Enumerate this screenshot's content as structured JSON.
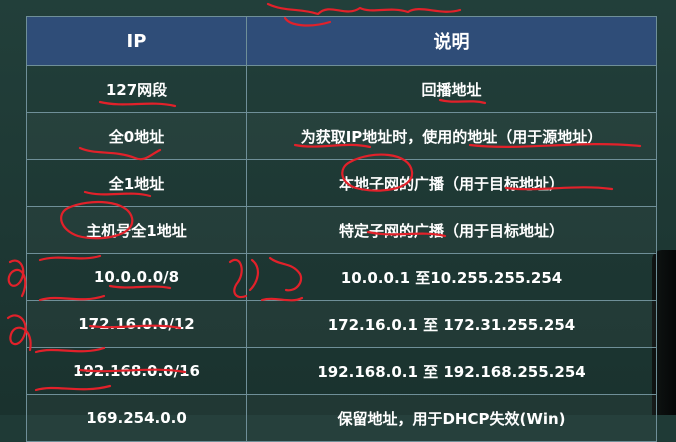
{
  "table": {
    "headers": {
      "ip": "IP",
      "desc": "说明"
    },
    "rows": [
      {
        "ip": "127网段",
        "desc": "回播地址"
      },
      {
        "ip": "全0地址",
        "desc": "为获取IP地址时，使用的地址（用于源地址）"
      },
      {
        "ip": "全1地址",
        "desc": "本地子网的广播（用于目标地址）"
      },
      {
        "ip": "主机号全1地址",
        "desc": "特定子网的广播（用于目标地址）"
      },
      {
        "ip": "10.0.0.0/8",
        "desc": "10.0.0.1 至10.255.255.254"
      },
      {
        "ip": "172.16.0.0/12",
        "desc": "172.16.0.1 至 172.31.255.254"
      },
      {
        "ip": "192.168.0.0/16",
        "desc": "192.168.0.1 至 192.168.255.254"
      },
      {
        "ip": "169.254.0.0",
        "desc": "保留地址，用于DHCP失效(Win)"
      }
    ]
  },
  "colors": {
    "header_bg": "#2f4d78",
    "board_bg": "#1f3a36",
    "annotation_ink": "#e2212a"
  }
}
